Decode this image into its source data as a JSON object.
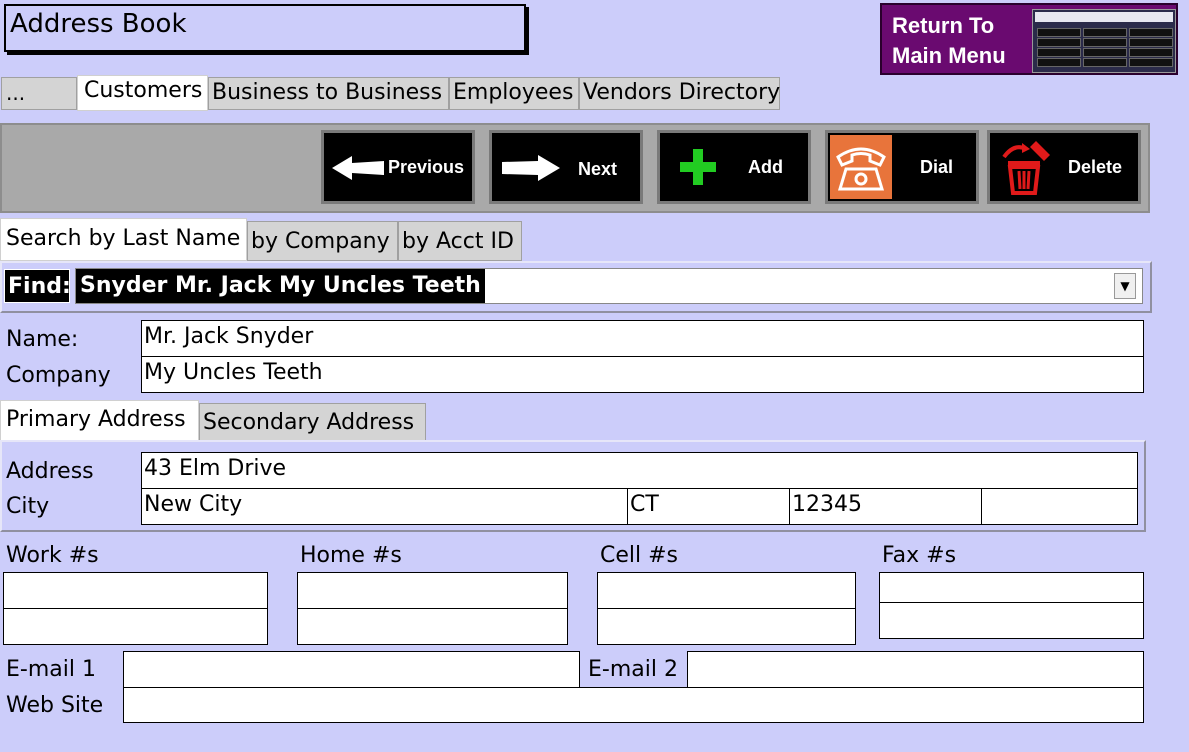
{
  "window": {
    "title": "Address Book"
  },
  "return_button": {
    "label_line1": "Return To",
    "label_line2": "Main Menu"
  },
  "main_tabs": [
    {
      "label": "..."
    },
    {
      "label": "Customers"
    },
    {
      "label": "Business to Business"
    },
    {
      "label": "Employees"
    },
    {
      "label": "Vendors Directory"
    }
  ],
  "toolbar": {
    "previous": "Previous",
    "next": "Next",
    "add": "Add",
    "dial": "Dial",
    "delete": "Delete"
  },
  "search_tabs": [
    {
      "label": "Search by Last Name"
    },
    {
      "label": "by Company"
    },
    {
      "label": "by Acct ID"
    }
  ],
  "find": {
    "label": "Find:",
    "value": "Snyder Mr. Jack  My Uncles Teeth"
  },
  "contact": {
    "name_label": "Name:",
    "name_value": "Mr. Jack  Snyder",
    "company_label": "Company",
    "company_value": "My Uncles Teeth"
  },
  "address_tabs": [
    {
      "label": "Primary Address"
    },
    {
      "label": "Secondary Address"
    }
  ],
  "address": {
    "address_label": "Address",
    "address_value": "43 Elm Drive",
    "city_label": "City",
    "city_value": "New City",
    "state_value": "CT",
    "zip_value": "12345",
    "extra_value": ""
  },
  "phones": {
    "work_label": "Work #s",
    "home_label": "Home #s",
    "cell_label": "Cell #s",
    "fax_label": "Fax #s"
  },
  "online": {
    "email1_label": "E-mail 1",
    "email2_label": "E-mail 2",
    "website_label": "Web Site",
    "email1_value": "",
    "email2_value": "",
    "website_value": ""
  },
  "colors": {
    "background": "#cccdfa",
    "return_button": "#6a0a70",
    "toolbar": "#a9a9a9",
    "add_icon": "#22cc22",
    "dial_icon": "#e8743b",
    "delete_icon": "#e01a1a"
  },
  "icons": {
    "previous": "arrow-left-icon",
    "next": "arrow-right-icon",
    "add": "plus-icon",
    "dial": "telephone-icon",
    "delete": "trash-icon"
  }
}
